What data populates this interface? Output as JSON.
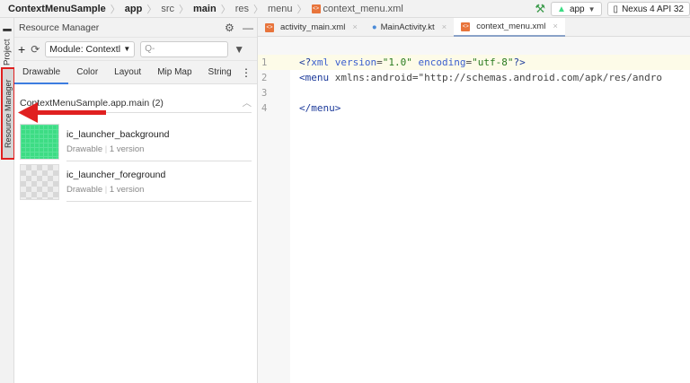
{
  "breadcrumb": [
    {
      "label": "ContextMenuSample",
      "bold": true
    },
    {
      "label": "app",
      "bold": true
    },
    {
      "label": "src",
      "bold": false
    },
    {
      "label": "main",
      "bold": true
    },
    {
      "label": "res",
      "bold": false
    },
    {
      "label": "menu",
      "bold": false
    },
    {
      "label": "context_menu.xml",
      "bold": false
    }
  ],
  "toolbar": {
    "run_config": "app",
    "device": "Nexus 4 API 32"
  },
  "side_strip": {
    "project": "Project",
    "resource_manager": "Resource Manager"
  },
  "panel": {
    "title": "Resource Manager",
    "module_select": "Module: Contextl",
    "search_placeholder": "Q-",
    "tabs": [
      "Drawable",
      "Color",
      "Layout",
      "Mip Map",
      "String"
    ],
    "active_tab": "Drawable",
    "section": "ContextMenuSample.app.main (2)",
    "items": [
      {
        "name": "ic_launcher_background",
        "type": "Drawable",
        "versions": "1 version"
      },
      {
        "name": "ic_launcher_foreground",
        "type": "Drawable",
        "versions": "1 version"
      }
    ]
  },
  "editor": {
    "tabs": [
      {
        "label": "activity_main.xml"
      },
      {
        "label": "MainActivity.kt"
      },
      {
        "label": "context_menu.xml",
        "active": true
      }
    ],
    "lines": [
      "1",
      "2",
      "3",
      "4"
    ]
  },
  "colors": {
    "accent": "#3d7de0",
    "highlight": "#e02020",
    "green": "#3ddc84"
  }
}
